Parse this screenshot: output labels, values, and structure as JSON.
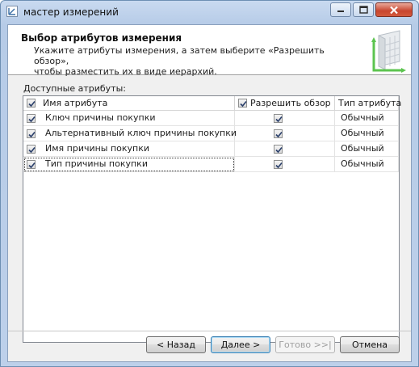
{
  "window": {
    "title": "мастер измерений"
  },
  "header": {
    "title": "Выбор атрибутов измерения",
    "subtitle_line1": "Укажите атрибуты измерения, а затем выберите «Разрешить обзор»,",
    "subtitle_line2": "чтобы разместить их в виде иерархий."
  },
  "attributes": {
    "section_label": "Доступные атрибуты:",
    "columns": {
      "name": "Имя атрибута",
      "browse": "Разрешить обзор",
      "type": "Тип атрибута"
    },
    "header_checked": true,
    "browse_header_checked": true,
    "rows": [
      {
        "checked": true,
        "name": "Ключ причины покупки",
        "browse": true,
        "type": "Обычный"
      },
      {
        "checked": true,
        "name": "Альтернативный ключ причины покупки",
        "browse": true,
        "type": "Обычный"
      },
      {
        "checked": true,
        "name": "Имя причины покупки",
        "browse": true,
        "type": "Обычный"
      },
      {
        "checked": true,
        "name": "Тип причины покупки",
        "browse": true,
        "type": "Обычный"
      }
    ]
  },
  "buttons": {
    "back": "< Назад",
    "next": "Далее >",
    "finish": "Готово >>|",
    "cancel": "Отмена"
  },
  "colors": {
    "accent": "#3c7fb1",
    "titlebar": "#b6cbe7",
    "close": "#c8452e"
  }
}
